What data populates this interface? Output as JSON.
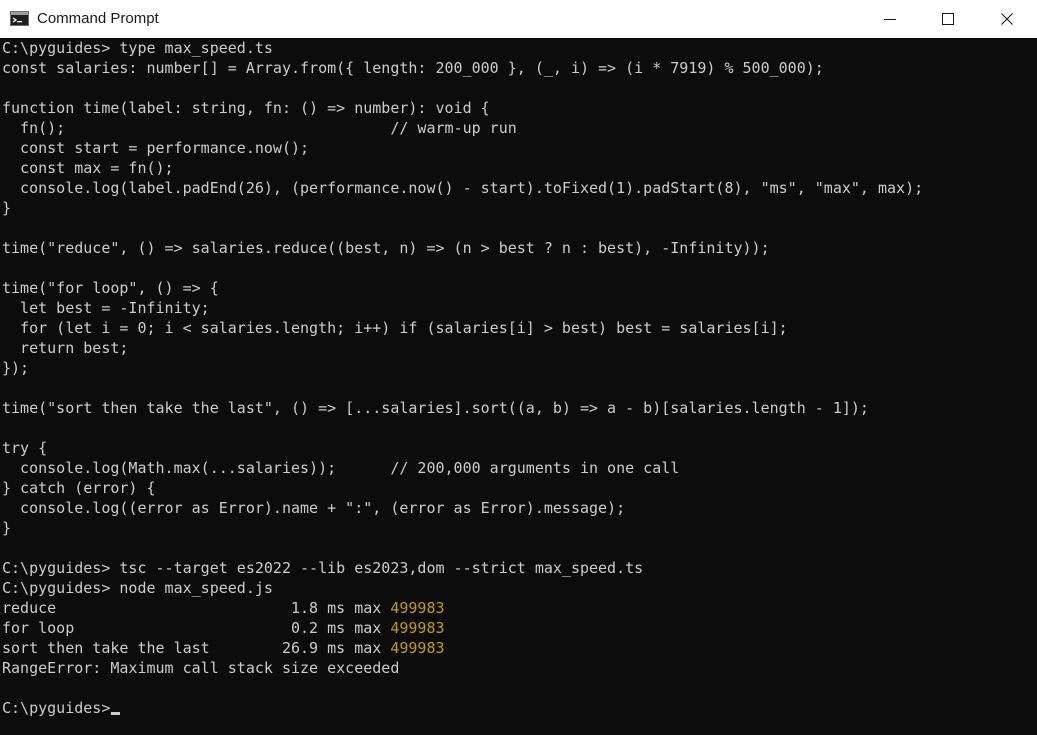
{
  "window": {
    "title": "Command Prompt",
    "app_icon": "command-prompt-icon",
    "controls": {
      "minimize": "minimize-icon",
      "maximize": "maximize-icon",
      "close": "close-icon"
    }
  },
  "colors": {
    "background": "#0c0c0c",
    "text": "#cccccc",
    "number_highlight": "#c19c00",
    "titlebar": "#ffffff"
  },
  "console": {
    "lines": [
      "C:\\pyguides> type max_speed.ts",
      "const salaries: number[] = Array.from({ length: 200_000 }, (_, i) => (i * 7919) % 500_000);",
      "",
      "function time(label: string, fn: () => number): void {",
      "  fn();                                    // warm-up run",
      "  const start = performance.now();",
      "  const max = fn();",
      "  console.log(label.padEnd(26), (performance.now() - start).toFixed(1).padStart(8), \"ms\", \"max\", max);",
      "}",
      "",
      "time(\"reduce\", () => salaries.reduce((best, n) => (n > best ? n : best), -Infinity));",
      "",
      "time(\"for loop\", () => {",
      "  let best = -Infinity;",
      "  for (let i = 0; i < salaries.length; i++) if (salaries[i] > best) best = salaries[i];",
      "  return best;",
      "});",
      "",
      "time(\"sort then take the last\", () => [...salaries].sort((a, b) => a - b)[salaries.length - 1]);",
      "",
      "try {",
      "  console.log(Math.max(...salaries));      // 200,000 arguments in one call",
      "} catch (error) {",
      "  console.log((error as Error).name + \":\", (error as Error).message);",
      "}",
      "",
      "C:\\pyguides> tsc --target es2022 --lib es2023,dom --strict max_speed.ts",
      "C:\\pyguides> node max_speed.js"
    ],
    "results": [
      {
        "prefix": "reduce                          1.8 ms max ",
        "value": "499983"
      },
      {
        "prefix": "for loop                        0.2 ms max ",
        "value": "499983"
      },
      {
        "prefix": "sort then take the last        26.9 ms max ",
        "value": "499983"
      }
    ],
    "error_line": "RangeError: Maximum call stack size exceeded",
    "blank_line": "",
    "prompt": "C:\\pyguides>"
  }
}
